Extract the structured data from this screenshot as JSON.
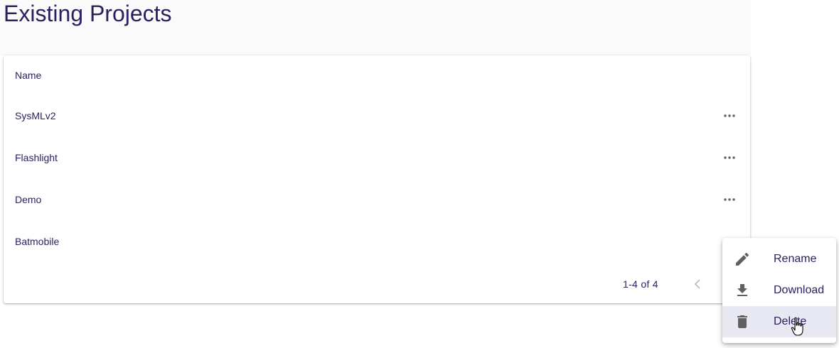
{
  "page": {
    "title": "Existing Projects"
  },
  "table": {
    "column_header": "Name",
    "rows": [
      {
        "name": "SysMLv2",
        "has_menu_button": true
      },
      {
        "name": "Flashlight",
        "has_menu_button": true
      },
      {
        "name": "Demo",
        "has_menu_button": true
      },
      {
        "name": "Batmobile",
        "has_menu_button": false
      }
    ],
    "row_menu_icon": "more-horizontal-icon"
  },
  "pagination": {
    "range_text": "1-4 of 4",
    "prev_icon": "chevron-left-icon"
  },
  "context_menu": {
    "items": [
      {
        "label": "Rename",
        "icon": "pencil-icon",
        "active": false
      },
      {
        "label": "Download",
        "icon": "download-icon",
        "active": false
      },
      {
        "label": "Delete",
        "icon": "trash-icon",
        "active": true
      }
    ]
  },
  "colors": {
    "text": "#2b2160",
    "icon": "#616161",
    "header_band": "#fafafa",
    "menu_active": "#e8e8f2"
  }
}
